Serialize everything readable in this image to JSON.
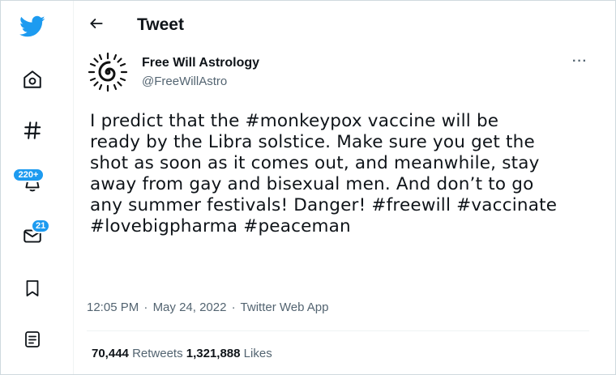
{
  "nav": {
    "notifications_badge": "220+",
    "messages_badge": "21",
    "brand_color": "#1d9bf0",
    "icons": [
      "twitter-bird-icon",
      "home-icon",
      "hashtag-icon",
      "bell-icon",
      "envelope-icon",
      "bookmark-icon",
      "list-icon"
    ]
  },
  "header": {
    "title": "Tweet"
  },
  "tweet": {
    "author_name": "Free Will Astrology",
    "author_handle": "@FreeWillAstro",
    "text": "I predict that the #monkeypox vaccine will be\nready by the Libra solstice. Make sure you get the\nshot as soon as it comes out, and meanwhile, stay\naway from gay and bisexual men. And don’t to go\nany summer festivals! Danger! #freewill #vaccinate\n#lovebigpharma #peaceman",
    "time": "12:05 PM",
    "separator": "·",
    "date": "May 24, 2022",
    "app": "Twitter Web App",
    "retweets_count": "70,444",
    "retweets_label": "Retweets",
    "likes_count": "1,321,888",
    "likes_label": "Likes"
  }
}
